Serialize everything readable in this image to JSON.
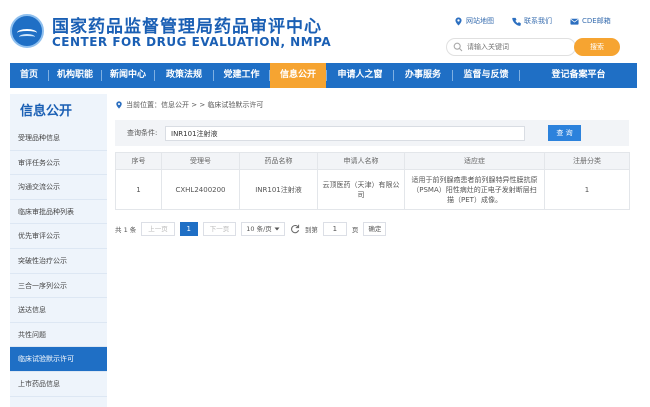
{
  "header": {
    "title_cn": "国家药品监督管理局药品审评中心",
    "title_en": "CENTER FOR DRUG EVALUATION, NMPA",
    "links": [
      "网站地图",
      "联系我们",
      "CDE邮箱"
    ],
    "search_placeholder": "请输入关键词",
    "search_button": "搜索"
  },
  "nav": {
    "items": [
      "首页",
      "机构职能",
      "新闻中心",
      "政策法规",
      "党建工作",
      "信息公开",
      "申请人之窗",
      "办事服务",
      "监督与反馈",
      "登记备案平台"
    ],
    "active_index": 5,
    "colors": {
      "primary": "#1f6fc5",
      "accent": "#f6a431"
    }
  },
  "sidebar": {
    "title": "信息公开",
    "items": [
      "受理品种信息",
      "审评任务公示",
      "沟通交流公示",
      "临床审批品种列表",
      "优先审评公示",
      "突破性治疗公示",
      "三合一序列公示",
      "送达信息",
      "共性问题",
      "临床试验默示许可",
      "上市药品信息"
    ],
    "active_index": 9
  },
  "breadcrumb": "当前位置：信息公开 > > 临床试验默示许可",
  "query": {
    "label": "查询条件:",
    "value": "INR101注射液",
    "button": "查 询"
  },
  "table": {
    "headers": [
      "序号",
      "受理号",
      "药品名称",
      "申请人名称",
      "适应症",
      "注册分类"
    ],
    "rows": [
      [
        "1",
        "CXHL2400200",
        "INR101注射液",
        "云顶医药（天津）有限公司",
        "适用于前列腺癌患者前列腺特异性膜抗原（PSMA）阳性病灶的正电子发射断层扫描（PET）成像。",
        "1"
      ]
    ]
  },
  "pager": {
    "total": "共 1 条",
    "prev": "上一页",
    "current": "1",
    "next": "下一页",
    "page_size": "10 条/页",
    "goto_label": "到第",
    "goto_value": "1",
    "page_unit": "页",
    "confirm": "确定"
  }
}
